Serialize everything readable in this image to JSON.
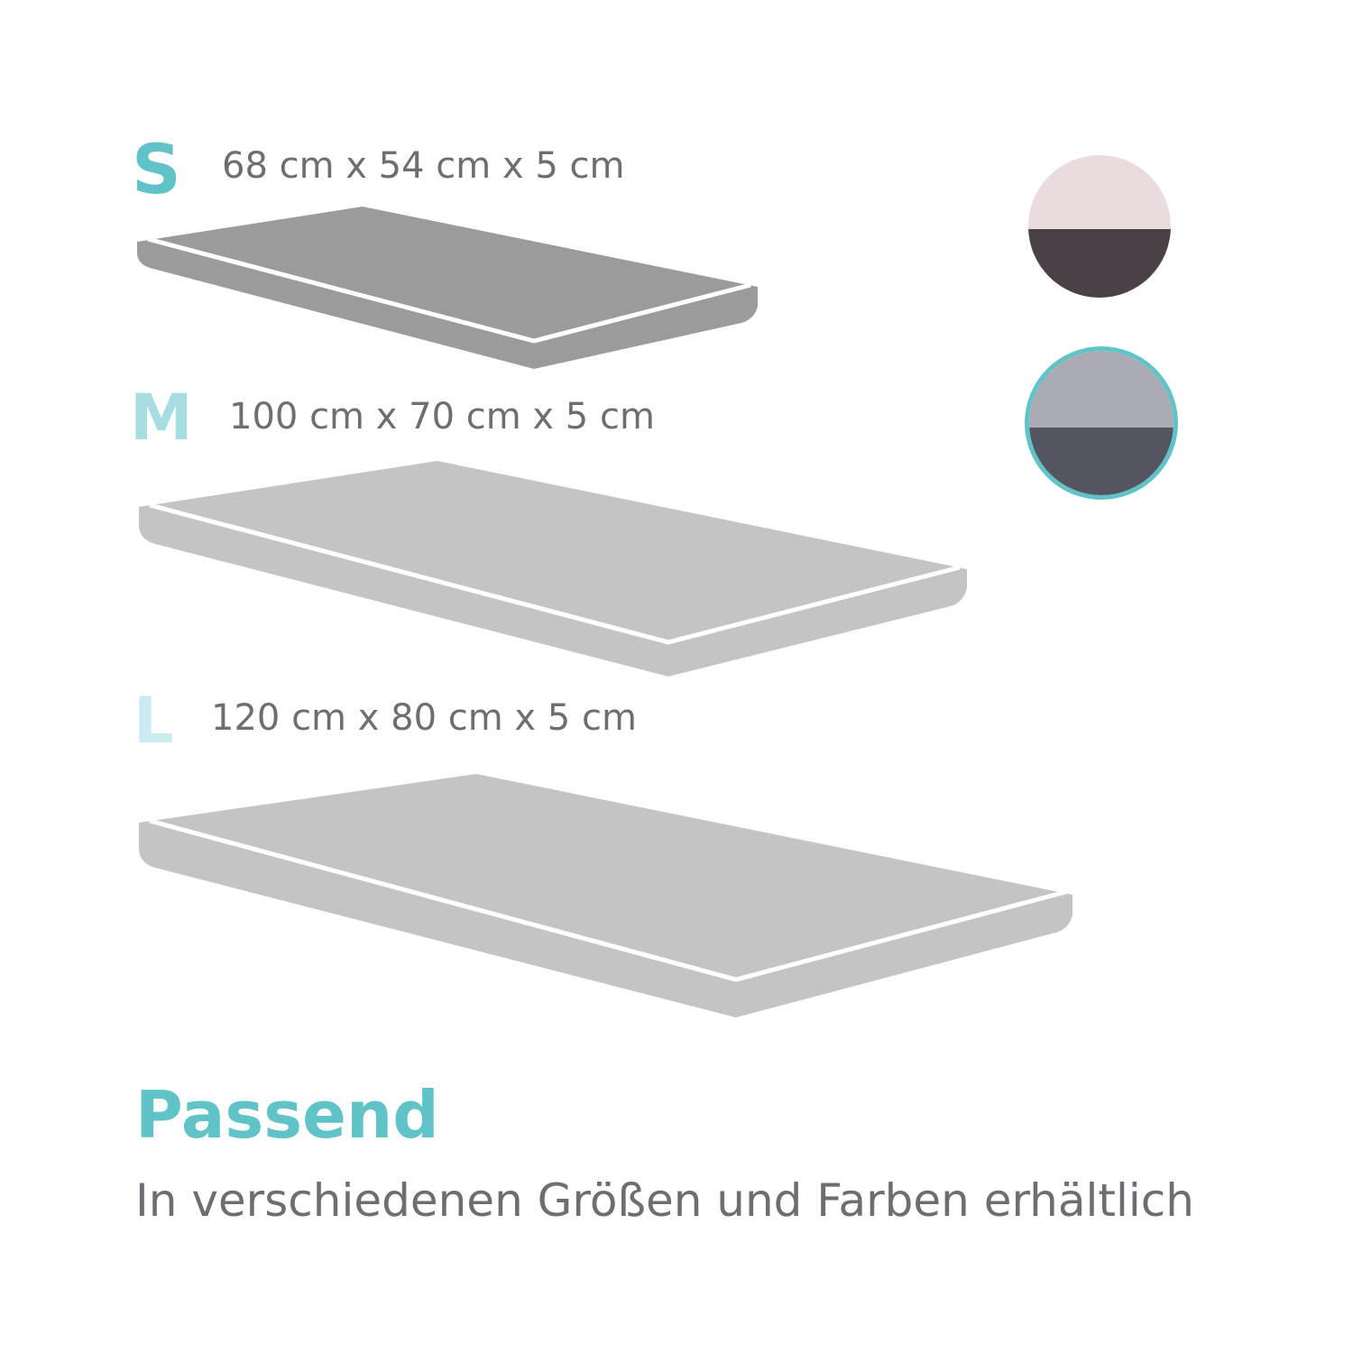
{
  "sizes": [
    {
      "label": "S",
      "dimensions": "68 cm x 54 cm x 5 cm",
      "mattress_color": "#9b9b9b"
    },
    {
      "label": "M",
      "dimensions": "100 cm x 70 cm x 5 cm",
      "mattress_color": "#c4c4c4"
    },
    {
      "label": "L",
      "dimensions": "120 cm x 80 cm x 5 cm",
      "mattress_color": "#c4c4c4"
    }
  ],
  "colors": {
    "accent": "#5fc3c7",
    "text": "#6e6e72"
  },
  "swatches": [
    {
      "top_color": "#eadbdd",
      "bottom_color": "#4a4148",
      "selected": false
    },
    {
      "top_color": "#ababb3",
      "bottom_color": "#535660",
      "selected": true
    }
  ],
  "headline": "Passend",
  "subline": "In verschiedenen Größen und Farben erhältlich"
}
